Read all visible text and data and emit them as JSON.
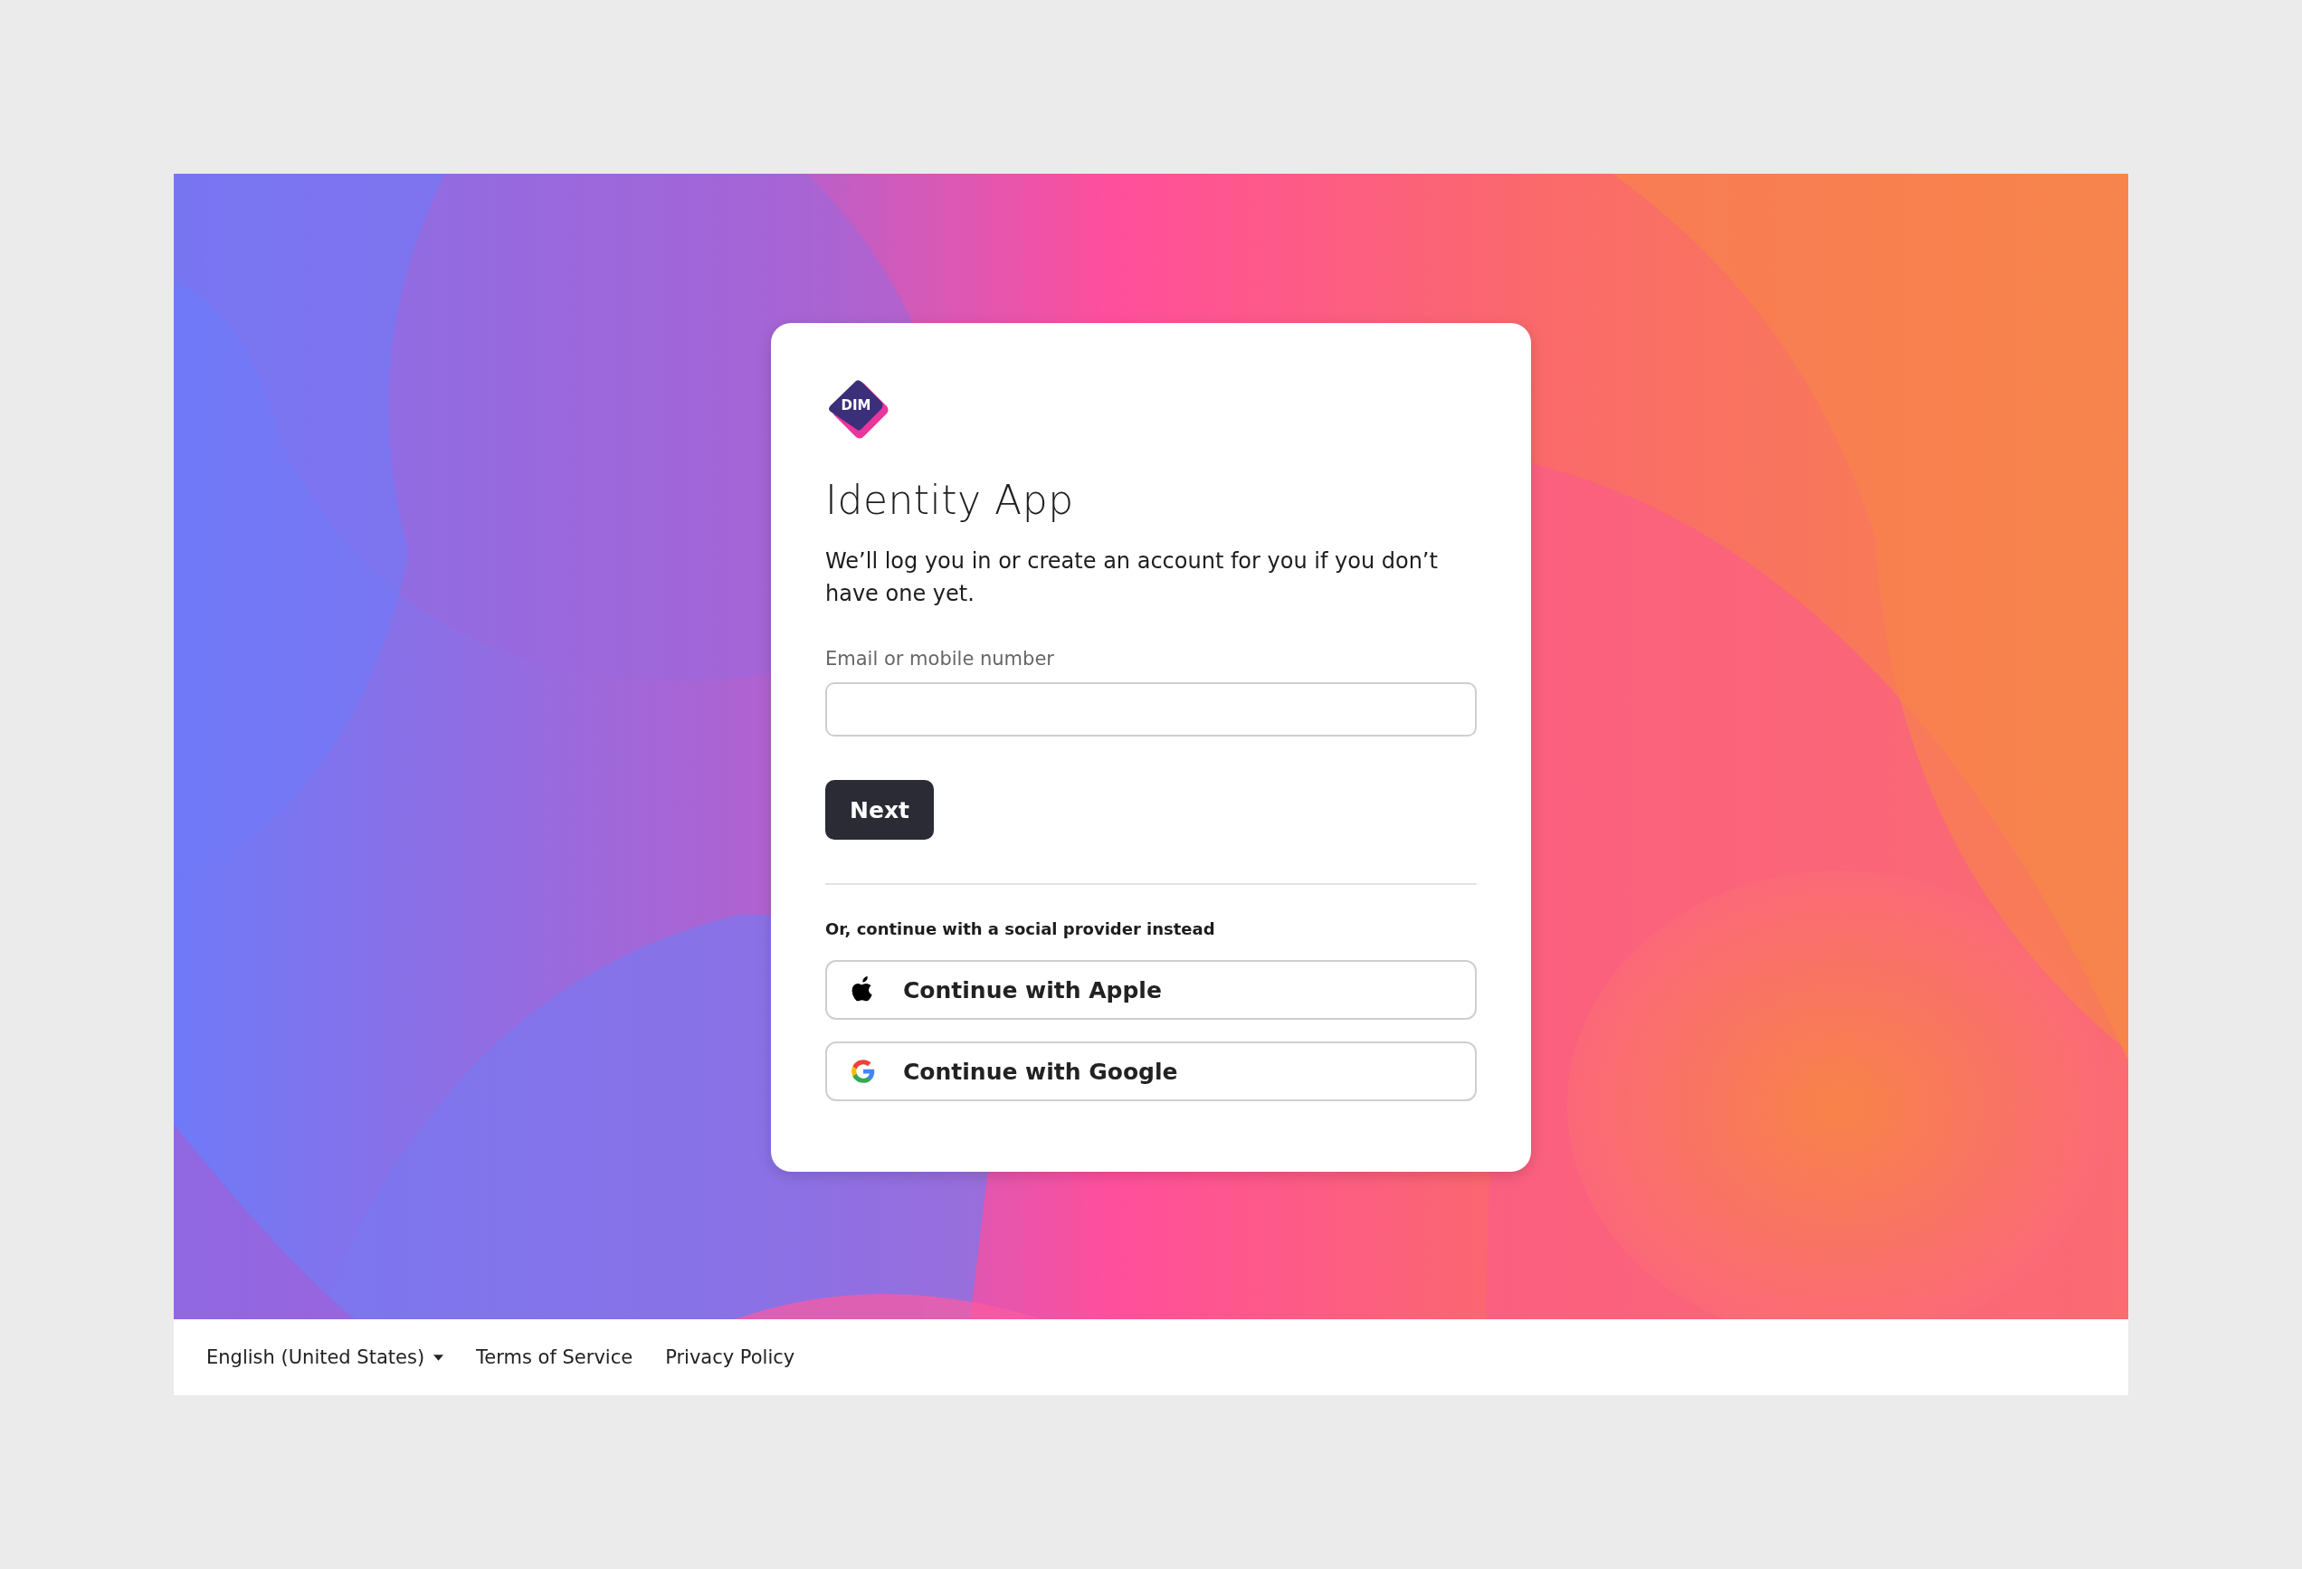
{
  "logo": {
    "text": "DIM"
  },
  "title": "Identity App",
  "intro": "We’ll log you in or create an account for you if you don’t have one yet.",
  "email_field": {
    "label": "Email or mobile number"
  },
  "next_button": "Next",
  "social_caption": "Or, continue with a social provider instead",
  "social_buttons": [
    {
      "kind": "apple",
      "label": "Continue with Apple"
    },
    {
      "kind": "google",
      "label": "Continue with Google"
    }
  ],
  "footer": {
    "language": "English (United States)",
    "links": [
      "Terms of Service",
      "Privacy Policy"
    ]
  }
}
